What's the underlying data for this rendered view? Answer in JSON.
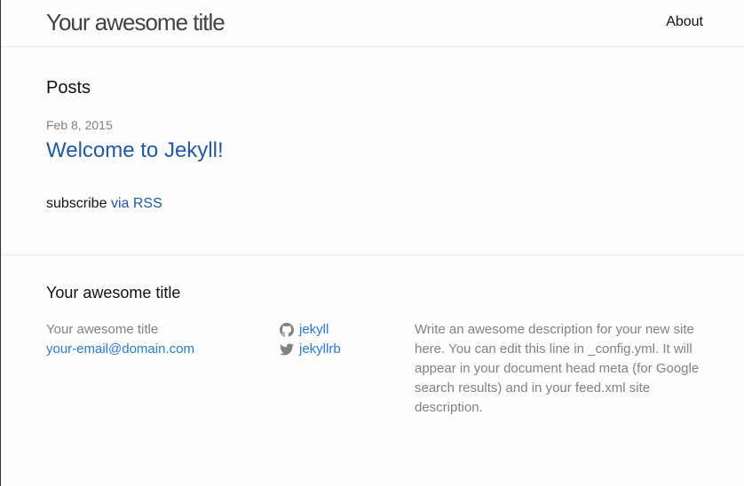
{
  "header": {
    "site_title": "Your awesome title",
    "nav": [
      {
        "label": "About"
      }
    ]
  },
  "main": {
    "heading": "Posts",
    "posts": [
      {
        "date": "Feb 8, 2015",
        "title": "Welcome to Jekyll!"
      }
    ],
    "subscribe_prefix": "subscribe",
    "subscribe_link": "via RSS"
  },
  "footer": {
    "heading": "Your awesome title",
    "name": "Your awesome title",
    "email": "your-email@domain.com",
    "social": [
      {
        "icon": "github-icon",
        "label": "jekyll"
      },
      {
        "icon": "twitter-icon",
        "label": "jekyllrb"
      }
    ],
    "description": "Write an awesome description for your new site here. You can edit this line in _config.yml. It will appear in your document head meta (for Google search results) and in your feed.xml site description."
  },
  "colors": {
    "link": "#2a7ae2",
    "muted": "#828282"
  }
}
